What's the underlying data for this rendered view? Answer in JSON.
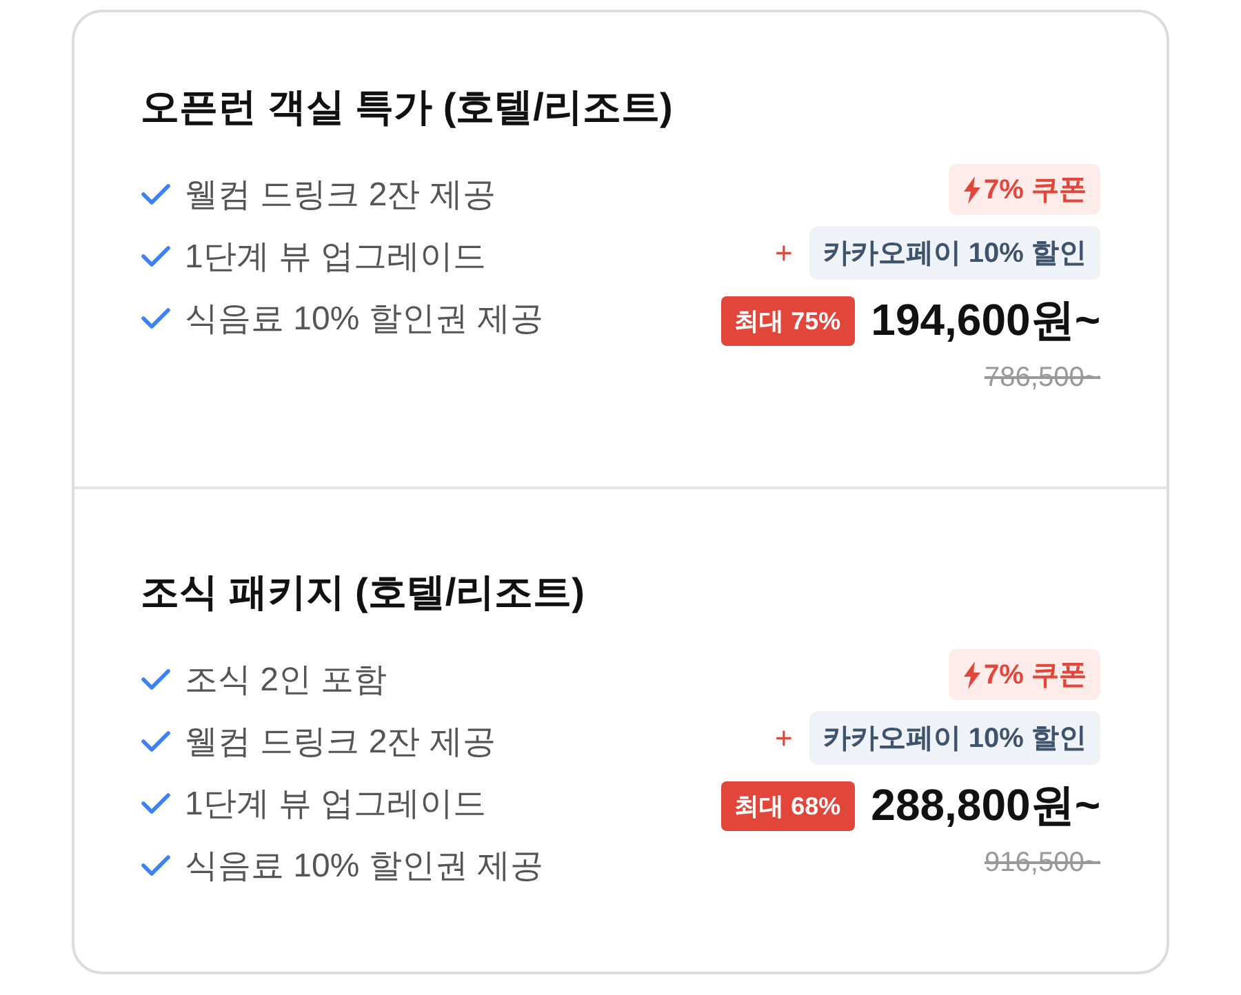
{
  "packages": [
    {
      "title": "오픈런 객실 특가 (호텔/리조트)",
      "benefits": [
        "웰컴 드링크 2잔 제공",
        "1단계 뷰 업그레이드",
        "식음료 10% 할인권 제공"
      ],
      "coupon": "7% 쿠폰",
      "plus": "+",
      "pay_discount": "카카오페이 10% 할인",
      "max_discount": "최대 75%",
      "price": "194,600원~",
      "original_price": "786,500~"
    },
    {
      "title": "조식 패키지 (호텔/리조트)",
      "benefits": [
        "조식 2인 포함",
        "웰컴 드링크 2잔 제공",
        "1단계 뷰 업그레이드",
        "식음료 10% 할인권 제공"
      ],
      "coupon": "7% 쿠폰",
      "plus": "+",
      "pay_discount": "카카오페이 10% 할인",
      "max_discount": "최대 68%",
      "price": "288,800원~",
      "original_price": "916,500~"
    }
  ]
}
